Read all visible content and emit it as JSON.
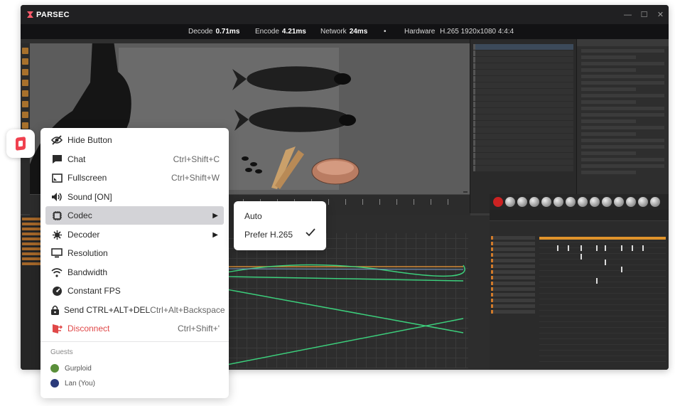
{
  "app": {
    "title": "PARSEC",
    "window_controls": [
      "minimize",
      "maximize",
      "close"
    ]
  },
  "stats": [
    {
      "label": "Decode",
      "value": "0.71ms"
    },
    {
      "label": "Encode",
      "value": "4.21ms"
    },
    {
      "label": "Network",
      "value": "24ms"
    },
    {
      "label": "Hardware",
      "value": "H.265 1920x1080 4:4:4"
    }
  ],
  "stats_separator": "•",
  "menu": {
    "items": [
      {
        "id": "hide-button",
        "label": "Hide Button",
        "shortcut": "",
        "icon": "eye-off-icon"
      },
      {
        "id": "chat",
        "label": "Chat",
        "shortcut": "Ctrl+Shift+C",
        "icon": "chat-icon"
      },
      {
        "id": "fullscreen",
        "label": "Fullscreen",
        "shortcut": "Ctrl+Shift+W",
        "icon": "fullscreen-icon"
      },
      {
        "id": "sound",
        "label": "Sound [ON]",
        "shortcut": "",
        "icon": "speaker-icon"
      },
      {
        "id": "codec",
        "label": "Codec",
        "shortcut": "",
        "icon": "chip-icon",
        "submenu": true,
        "active": true
      },
      {
        "id": "decoder",
        "label": "Decoder",
        "shortcut": "",
        "icon": "cpu-icon",
        "submenu": true
      },
      {
        "id": "resolution",
        "label": "Resolution",
        "shortcut": "",
        "icon": "monitor-icon"
      },
      {
        "id": "bandwidth",
        "label": "Bandwidth",
        "shortcut": "",
        "icon": "wifi-icon"
      },
      {
        "id": "constant-fps",
        "label": "Constant FPS",
        "shortcut": "",
        "icon": "gauge-icon"
      },
      {
        "id": "send-cad",
        "label": "Send CTRL+ALT+DEL",
        "shortcut": "Ctrl+Alt+Backspace",
        "icon": "lock-icon"
      },
      {
        "id": "disconnect",
        "label": "Disconnect",
        "shortcut": "Ctrl+Shift+'",
        "icon": "disconnect-icon",
        "danger": true
      }
    ],
    "guests_header": "Guests",
    "guests": [
      {
        "name": "Gurploid",
        "avatar_color": "#5a8f3a"
      },
      {
        "name": "Lan (You)",
        "avatar_color": "#2a3a7a"
      }
    ]
  },
  "codec_submenu": {
    "items": [
      {
        "label": "Auto",
        "selected": false
      },
      {
        "label": "Prefer H.265",
        "selected": true
      }
    ]
  },
  "colors": {
    "accent": "#f0414f",
    "danger": "#e04848",
    "active_row": "#d3d3d7"
  }
}
